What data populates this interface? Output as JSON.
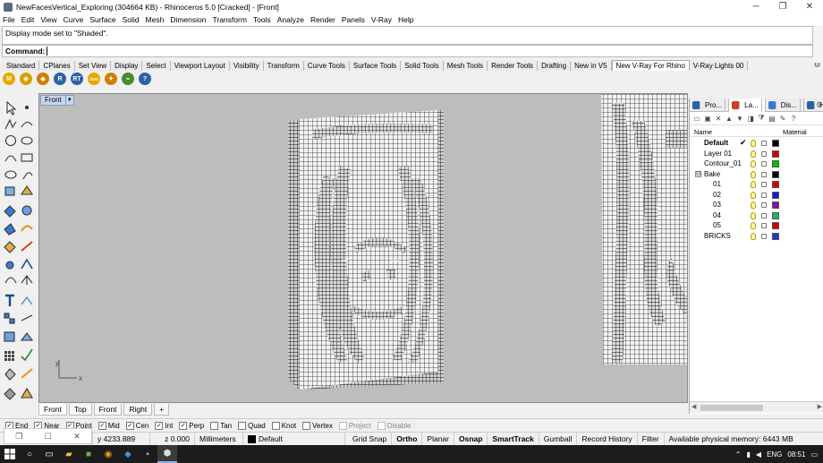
{
  "window": {
    "title": "NewFacesVertical_Exploring (304664 KB) - Rhinoceros 5.0 [Cracked] - [Front]",
    "min_glyph": "─",
    "max_glyph": "❐",
    "close_glyph": "✕"
  },
  "menu": [
    "File",
    "Edit",
    "View",
    "Curve",
    "Surface",
    "Solid",
    "Mesh",
    "Dimension",
    "Transform",
    "Tools",
    "Analyze",
    "Render",
    "Panels",
    "V-Ray",
    "Help"
  ],
  "command": {
    "history": "Display mode set to \"Shaded\".",
    "prompt": "Command:"
  },
  "toolbar_tabs": [
    "Standard",
    "CPlanes",
    "Set View",
    "Display",
    "Select",
    "Viewport Layout",
    "Visibility",
    "Transform",
    "Curve Tools",
    "Surface Tools",
    "Solid Tools",
    "Mesh Tools",
    "Render Tools",
    "Drafting",
    "New in V5",
    "New V-Ray For Rhino",
    "V-Ray Lights 00"
  ],
  "active_toolbar_tab": "New V-Ray For Rhino",
  "vray_tools": [
    {
      "icon": "vray-render-icon",
      "glyph": "M",
      "color": "#e8a800"
    },
    {
      "icon": "vray-options-icon",
      "glyph": "◈",
      "color": "#d9a000"
    },
    {
      "icon": "vray-frame-buffer-icon",
      "glyph": "◆",
      "color": "#d08000"
    },
    {
      "icon": "vray-rt-icon",
      "glyph": "R",
      "color": "#2a62a8"
    },
    {
      "icon": "vray-rt-render-icon",
      "glyph": "RT",
      "color": "#2a62a8"
    },
    {
      "icon": "vray-sun-icon",
      "glyph": "SUN",
      "color": "#e8a800"
    },
    {
      "icon": "vray-light-icon",
      "glyph": "✦",
      "color": "#d08000"
    },
    {
      "icon": "vray-fur-icon",
      "glyph": "⌁",
      "color": "#4a8a30"
    },
    {
      "icon": "vray-help-icon",
      "glyph": "?",
      "color": "#2a62a8"
    }
  ],
  "viewport": {
    "name": "Front",
    "dropdown_glyph": "▼",
    "axis_y": "y",
    "axis_x": "x"
  },
  "viewport_tabs": [
    "Front",
    "Top",
    "Front",
    "Right"
  ],
  "viewport_add": "+",
  "panel": {
    "tabs": [
      "Pro...",
      "La...",
      "Dis...",
      "Help"
    ],
    "col_name": "Name",
    "col_material": "Material",
    "layers": [
      {
        "name": "Default",
        "bold": true,
        "current": true,
        "indent": 0,
        "color": "#000000",
        "check": "✔"
      },
      {
        "name": "Layer 01",
        "indent": 0,
        "color": "#d40000"
      },
      {
        "name": "Contour_01",
        "indent": 0,
        "color": "#00c000"
      },
      {
        "name": "Bake",
        "indent": 0,
        "color": "#000000",
        "expander": "⊟"
      },
      {
        "name": "01",
        "indent": 1,
        "color": "#d40000"
      },
      {
        "name": "02",
        "indent": 1,
        "color": "#1a1ad0"
      },
      {
        "name": "03",
        "indent": 1,
        "color": "#8010a0"
      },
      {
        "name": "04",
        "indent": 1,
        "color": "#20b070"
      },
      {
        "name": "05",
        "indent": 1,
        "color": "#d40000"
      },
      {
        "name": "BRICKS",
        "indent": 0,
        "color": "#1a3ad0"
      }
    ]
  },
  "osnaps": [
    {
      "label": "End",
      "checked": true
    },
    {
      "label": "Near",
      "checked": true
    },
    {
      "label": "Point",
      "checked": true
    },
    {
      "label": "Mid",
      "checked": true
    },
    {
      "label": "Cen",
      "checked": true
    },
    {
      "label": "Int",
      "checked": true
    },
    {
      "label": "Perp",
      "checked": true
    },
    {
      "label": "Tan",
      "checked": false
    },
    {
      "label": "Quad",
      "checked": false
    },
    {
      "label": "Knot",
      "checked": false
    },
    {
      "label": "Vertex",
      "checked": false
    },
    {
      "label": "Project",
      "checked": false,
      "disabled": true
    },
    {
      "label": "Disable",
      "checked": false,
      "disabled": true
    }
  ],
  "status": {
    "y": "y 4233.889",
    "z": "z 0.000",
    "units": "Millimeters",
    "layer": "Default",
    "grid_snap": "Grid Snap",
    "ortho": "Ortho",
    "planar": "Planar",
    "osnap": "Osnap",
    "smarttrack": "SmartTrack",
    "gumball": "Gumball",
    "record_history": "Record History",
    "filter": "Filter",
    "memory": "Available physical memory: 6443 MB"
  },
  "taskbar": {
    "time": "08:51",
    "lang": "ENG"
  }
}
